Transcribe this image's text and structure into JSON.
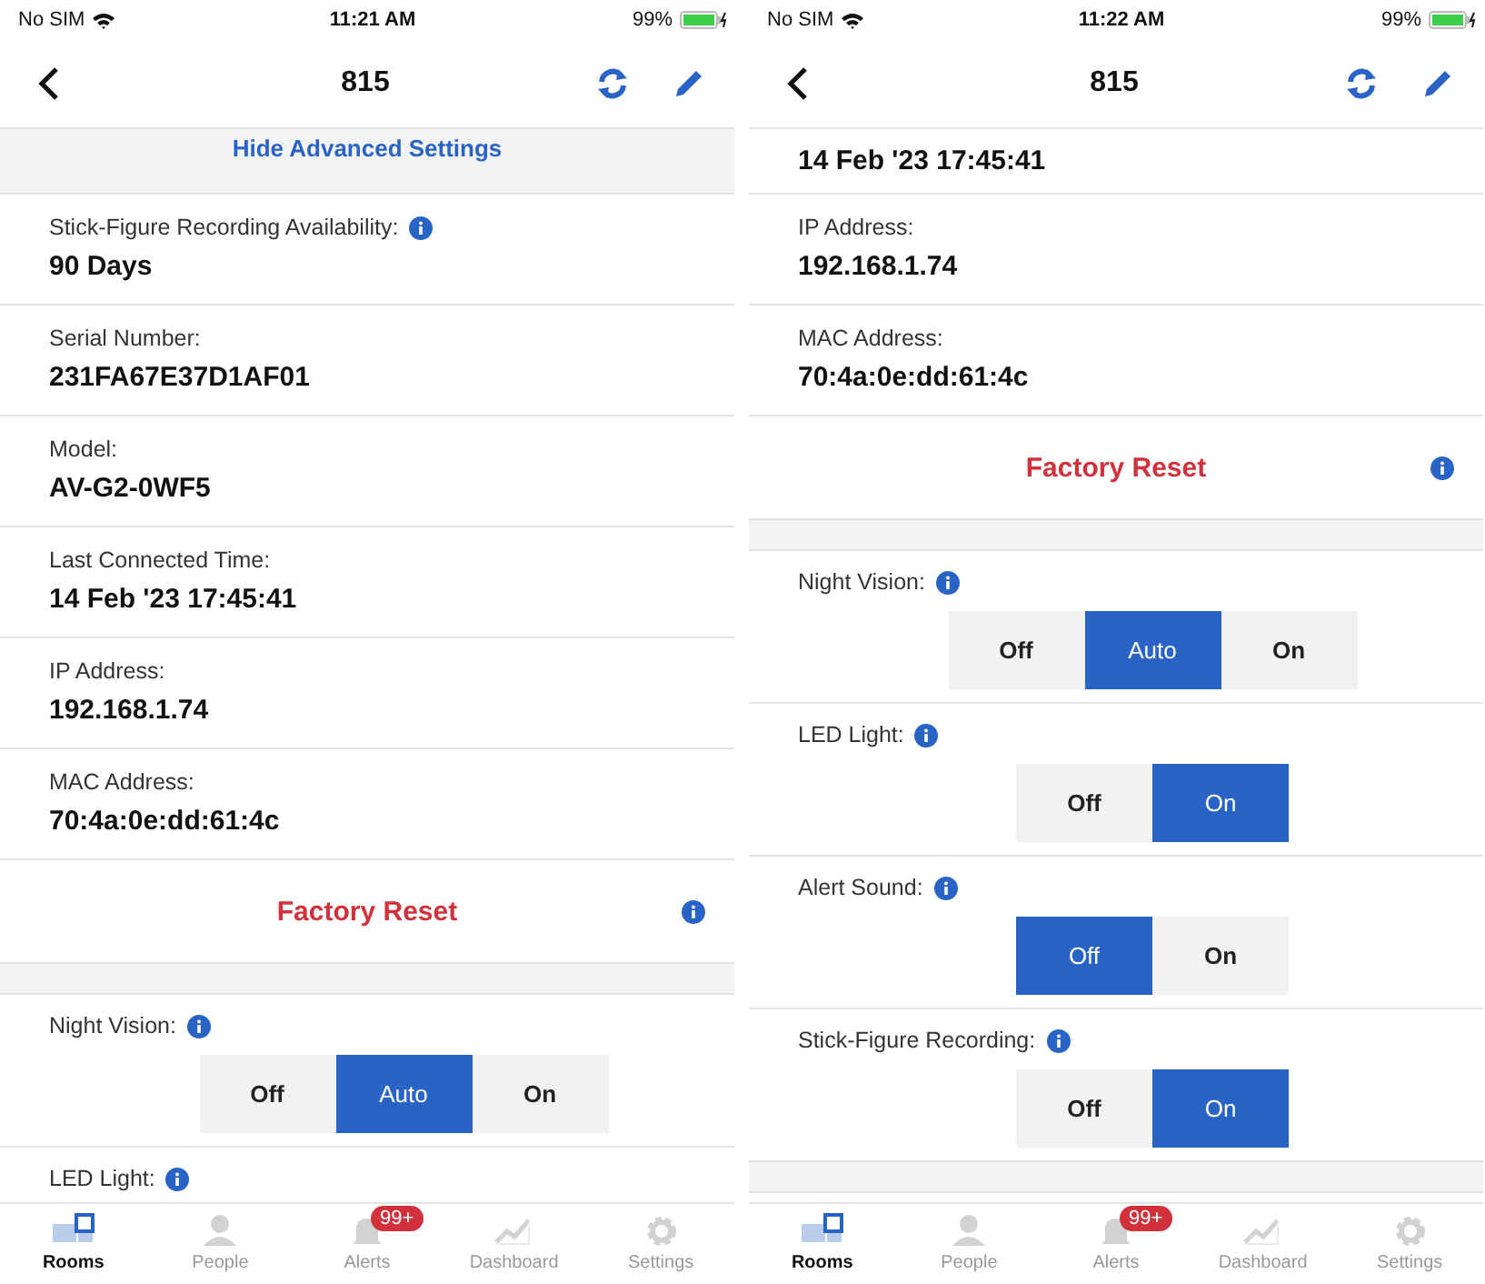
{
  "screens": [
    {
      "status_bar": {
        "carrier": "No SIM",
        "time": "11:21 AM",
        "battery": "99%"
      },
      "title": "815",
      "rows": [
        {
          "kind": "link",
          "text": "Hide Advanced Settings"
        },
        {
          "kind": "field",
          "label": "Stick-Figure Recording Availability:",
          "info": true,
          "value": "90 Days"
        },
        {
          "kind": "field",
          "label": "Serial Number:",
          "info": false,
          "value": "231FA67E37D1AF01"
        },
        {
          "kind": "field",
          "label": "Model:",
          "info": false,
          "value": "AV-G2-0WF5"
        },
        {
          "kind": "field",
          "label": "Last Connected Time:",
          "info": false,
          "value": "14 Feb '23 17:45:41"
        },
        {
          "kind": "field",
          "label": "IP Address:",
          "info": false,
          "value": "192.168.1.74"
        },
        {
          "kind": "field",
          "label": "MAC Address:",
          "info": false,
          "value": "70:4a:0e:dd:61:4c"
        },
        {
          "kind": "action",
          "text": "Factory Reset",
          "info": true
        },
        {
          "kind": "spacer"
        },
        {
          "kind": "segmented",
          "label": "Night Vision:",
          "info": true,
          "options": [
            {
              "label": "Off",
              "selected": false
            },
            {
              "label": "Auto",
              "selected": true
            },
            {
              "label": "On",
              "selected": false
            }
          ]
        },
        {
          "kind": "segmented",
          "label": "LED Light:",
          "info": true,
          "options": []
        }
      ],
      "tabs": [
        {
          "label": "Rooms",
          "selected": true
        },
        {
          "label": "People",
          "selected": false
        },
        {
          "label": "Alerts",
          "selected": false,
          "badge": "99+"
        },
        {
          "label": "Dashboard",
          "selected": false
        },
        {
          "label": "Settings",
          "selected": false
        }
      ]
    },
    {
      "status_bar": {
        "carrier": "No SIM",
        "time": "11:22 AM",
        "battery": "99%"
      },
      "title": "815",
      "rows": [
        {
          "kind": "field",
          "value": "14 Feb '23 17:45:41"
        },
        {
          "kind": "field",
          "label": "IP Address:",
          "info": false,
          "value": "192.168.1.74"
        },
        {
          "kind": "field",
          "label": "MAC Address:",
          "info": false,
          "value": "70:4a:0e:dd:61:4c"
        },
        {
          "kind": "action",
          "text": "Factory Reset",
          "info": true
        },
        {
          "kind": "spacer"
        },
        {
          "kind": "segmented",
          "label": "Night Vision:",
          "info": true,
          "options": [
            {
              "label": "Off",
              "selected": false
            },
            {
              "label": "Auto",
              "selected": true
            },
            {
              "label": "On",
              "selected": false
            }
          ]
        },
        {
          "kind": "segmented",
          "label": "LED Light:",
          "info": true,
          "options": [
            {
              "label": "Off",
              "selected": false
            },
            {
              "label": "On",
              "selected": true
            }
          ]
        },
        {
          "kind": "segmented",
          "label": "Alert Sound:",
          "info": true,
          "options": [
            {
              "label": "Off",
              "selected": true
            },
            {
              "label": "On",
              "selected": false
            }
          ]
        },
        {
          "kind": "segmented",
          "label": "Stick-Figure Recording:",
          "info": true,
          "options": [
            {
              "label": "Off",
              "selected": false
            },
            {
              "label": "On",
              "selected": true
            }
          ]
        },
        {
          "kind": "spacer"
        }
      ],
      "tabs": [
        {
          "label": "Rooms",
          "selected": true
        },
        {
          "label": "People",
          "selected": false
        },
        {
          "label": "Alerts",
          "selected": false,
          "badge": "99+"
        },
        {
          "label": "Dashboard",
          "selected": false
        },
        {
          "label": "Settings",
          "selected": false
        }
      ]
    }
  ]
}
